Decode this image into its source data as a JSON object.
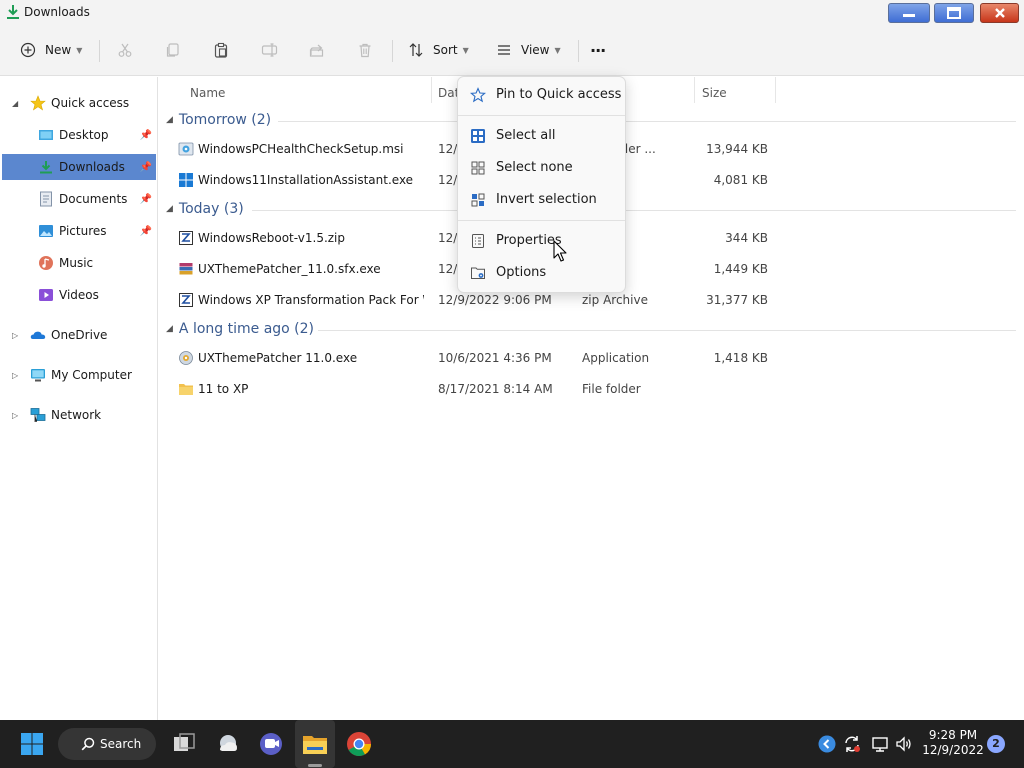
{
  "window": {
    "title": "Downloads",
    "controls": {
      "minimize": "—",
      "maximize": "▭",
      "close": "✕"
    }
  },
  "toolbar": {
    "new_label": "New",
    "sort_label": "Sort",
    "view_label": "View",
    "more_label": "···",
    "icons": [
      "cut-icon",
      "copy-icon",
      "paste-icon",
      "rename-icon",
      "share-icon",
      "delete-icon"
    ]
  },
  "sidebar": {
    "items": [
      {
        "label": "Quick access",
        "icon": "star-icon",
        "expanded": true
      },
      {
        "label": "Desktop",
        "icon": "desktop-icon",
        "pinned": true
      },
      {
        "label": "Downloads",
        "icon": "download-icon",
        "pinned": true,
        "selected": true
      },
      {
        "label": "Documents",
        "icon": "documents-icon",
        "pinned": true
      },
      {
        "label": "Pictures",
        "icon": "pictures-icon",
        "pinned": true
      },
      {
        "label": "Music",
        "icon": "music-icon"
      },
      {
        "label": "Videos",
        "icon": "videos-icon"
      },
      {
        "label": "OneDrive",
        "icon": "onedrive-icon"
      },
      {
        "label": "My Computer",
        "icon": "computer-icon"
      },
      {
        "label": "Network",
        "icon": "network-icon"
      }
    ]
  },
  "columns": {
    "name": "Name",
    "date": "Dat",
    "size": "Size"
  },
  "groups": [
    {
      "label": "Tomorrow (2)",
      "files": [
        {
          "name": "WindowsPCHealthCheckSetup.msi",
          "date": "12/",
          "type": "s Installer ...",
          "size": "13,944 KB",
          "icon": "msi-icon"
        },
        {
          "name": "Windows11InstallationAssistant.exe",
          "date": "12/",
          "type": "ation",
          "size": "4,081 KB",
          "icon": "windows-app-icon"
        }
      ]
    },
    {
      "label": "Today (3)",
      "files": [
        {
          "name": "WindowsReboot-v1.5.zip",
          "date": "12/9",
          "type": "chive",
          "size": "344 KB",
          "icon": "zip-icon"
        },
        {
          "name": "UXThemePatcher_11.0.sfx.exe",
          "date": "12/9",
          "type": "ation",
          "size": "1,449 KB",
          "icon": "sfx-icon"
        },
        {
          "name": "Windows XP Transformation Pack For Wi...",
          "date": "12/9/2022 9:06 PM",
          "type": "zip Archive",
          "size": "31,377 KB",
          "icon": "zip-icon"
        }
      ]
    },
    {
      "label": "A long time ago (2)",
      "files": [
        {
          "name": "UXThemePatcher 11.0.exe",
          "date": "10/6/2021 4:36 PM",
          "type": "Application",
          "size": "1,418 KB",
          "icon": "exe-icon"
        },
        {
          "name": "11 to XP",
          "date": "8/17/2021 8:14 AM",
          "type": "File folder",
          "size": "",
          "icon": "folder-icon"
        }
      ]
    }
  ],
  "context_menu": {
    "items": [
      {
        "label": "Pin to Quick access",
        "icon": "pin-star-icon"
      },
      {
        "label": "Select all",
        "icon": "select-all-icon"
      },
      {
        "label": "Select none",
        "icon": "select-none-icon"
      },
      {
        "label": "Invert selection",
        "icon": "invert-selection-icon"
      },
      {
        "label": "Properties",
        "icon": "properties-icon"
      },
      {
        "label": "Options",
        "icon": "options-icon"
      }
    ]
  },
  "taskbar": {
    "search_label": "Search",
    "clock_time": "9:28 PM",
    "clock_date": "12/9/2022",
    "notification_count": "2"
  },
  "colors": {
    "selection": "#5b87cf",
    "group_text": "#3b5b8f",
    "taskbar_bg": "#202020",
    "accent": "#0078d4"
  }
}
